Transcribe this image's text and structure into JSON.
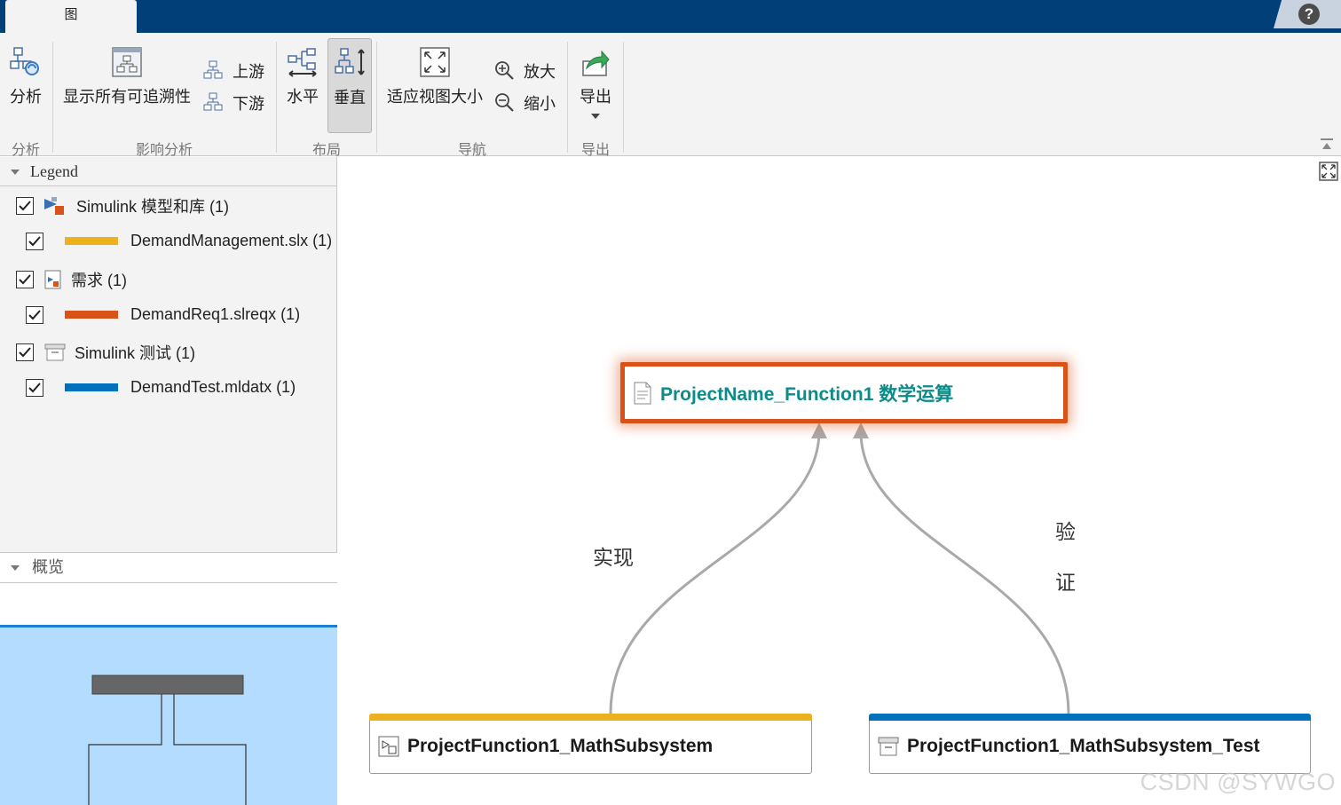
{
  "window": {
    "tab_label": "图",
    "help_label": "?"
  },
  "ribbon": {
    "groups": {
      "analysis": {
        "label": "分析",
        "analyze_btn": "分析"
      },
      "impact": {
        "label": "影响分析",
        "show_all_btn": "显示所有可追溯性",
        "upstream_btn": "上游",
        "downstream_btn": "下游"
      },
      "layout": {
        "label": "布局",
        "horizontal_btn": "水平",
        "vertical_btn": "垂直"
      },
      "navigate": {
        "label": "导航",
        "fit_btn": "适应视图大小",
        "zoom_in_btn": "放大",
        "zoom_out_btn": "缩小"
      },
      "export": {
        "label": "导出",
        "export_btn": "导出"
      }
    }
  },
  "legend": {
    "title": "Legend",
    "items": [
      {
        "label": "Simulink 模型和库 (1)",
        "checked": true,
        "icon": "simulink-model-icon"
      },
      {
        "label": "DemandManagement.slx (1)",
        "checked": true,
        "color": "#edb120"
      },
      {
        "label": "需求 (1)",
        "checked": true,
        "icon": "requirement-icon"
      },
      {
        "label": "DemandReq1.slreqx (1)",
        "checked": true,
        "color": "#d95319"
      },
      {
        "label": "Simulink 测试 (1)",
        "checked": true,
        "icon": "test-icon"
      },
      {
        "label": "DemandTest.mldatx (1)",
        "checked": true,
        "color": "#0072bd"
      }
    ]
  },
  "overview": {
    "title": "概览"
  },
  "graph": {
    "nodes": {
      "requirement": {
        "label": "ProjectName_Function1 数学运算",
        "color": "#d95319"
      },
      "model": {
        "label": "ProjectFunction1_MathSubsystem",
        "color": "#edb120"
      },
      "test": {
        "label": "ProjectFunction1_MathSubsystem_Test",
        "color": "#0072bd"
      }
    },
    "edges": {
      "implements": {
        "label": "实现"
      },
      "verifies": {
        "label_line1": "验",
        "label_line2": "证"
      }
    }
  },
  "watermark": "CSDN @SYWGO"
}
